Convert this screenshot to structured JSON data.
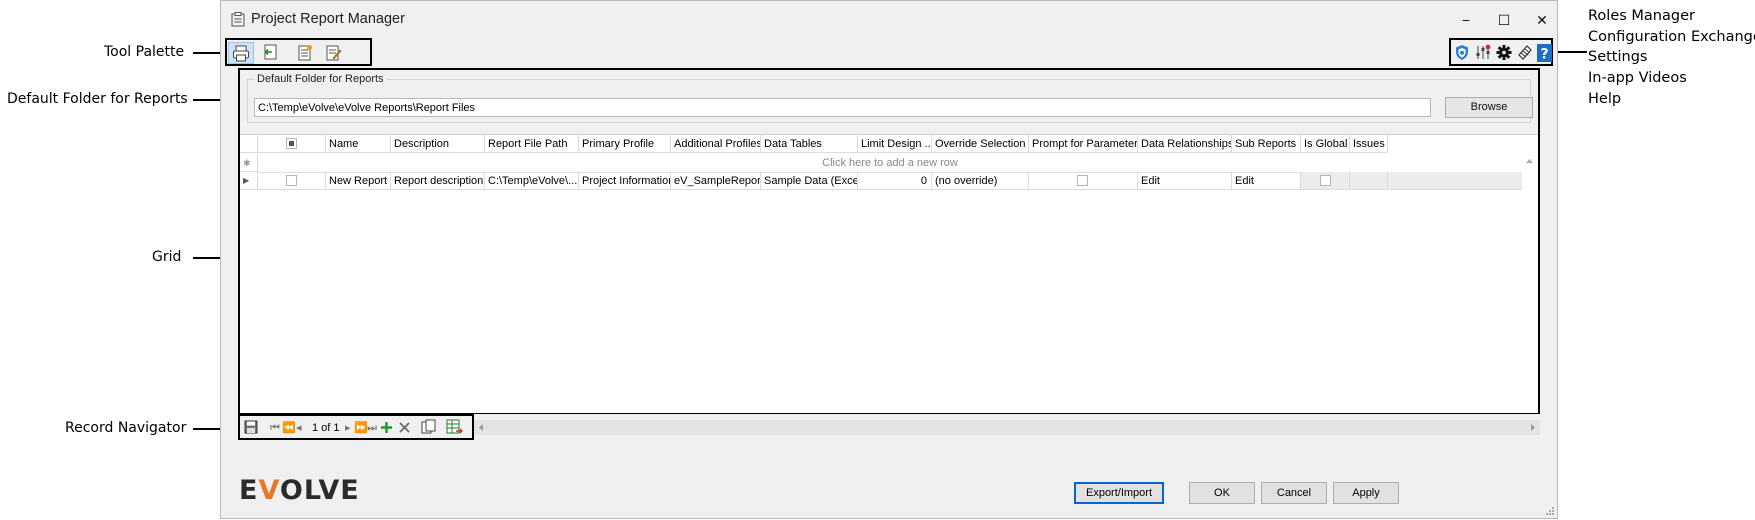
{
  "annotations": {
    "tool_palette": "Tool Palette",
    "default_folder": "Default Folder for Reports",
    "grid": "Grid",
    "record_navigator": "Record Navigator",
    "right": [
      "Roles Manager",
      "Configuration Exchange",
      "Settings",
      "In-app Videos",
      "Help"
    ]
  },
  "window": {
    "title": "Project Report Manager",
    "minimize": "−",
    "maximize": "☐",
    "close": "✕"
  },
  "toolbar": {
    "left_icons": [
      "printer-icon",
      "export-icon",
      "new-report-icon",
      "edit-report-icon"
    ],
    "right_icons": [
      "shield-icon",
      "configuration-exchange-icon",
      "gear-icon",
      "video-icon",
      "help-icon"
    ]
  },
  "folder": {
    "legend": "Default Folder for Reports",
    "path": "C:\\Temp\\eVolve\\eVolve Reports\\Report Files",
    "browse": "Browse"
  },
  "grid": {
    "columns": [
      "Name",
      "Description",
      "Report File Path",
      "Primary Profile",
      "Additional Profiles",
      "Data Tables",
      "Limit Design ...",
      "Override Selection ...",
      "Prompt for Parameters",
      "Data Relationships",
      "Sub Reports",
      "Is Global",
      "Issues"
    ],
    "new_row_text": "Click here to add a new row",
    "rows": [
      {
        "name": "New Report",
        "description": "Report description",
        "file_path": "C:\\Temp\\eVolve\\...",
        "primary_profile": "Project Information",
        "additional_profiles": "eV_SampleReport",
        "data_tables": "Sample Data (Excel)",
        "limit_design": "0",
        "override_selection": "(no override)",
        "data_relationships": "Edit",
        "sub_reports": "Edit"
      }
    ]
  },
  "navigator": {
    "record_text": "1 of 1"
  },
  "footer": {
    "logo_pre": "E",
    "logo_v": "V",
    "logo_post": "OLVE",
    "export_import": "Export/Import",
    "ok": "OK",
    "cancel": "Cancel",
    "apply": "Apply"
  },
  "colors": {
    "accent": "#0a64c8",
    "logo_orange": "#e8762b",
    "selected_tool": "#cfe3f8"
  }
}
